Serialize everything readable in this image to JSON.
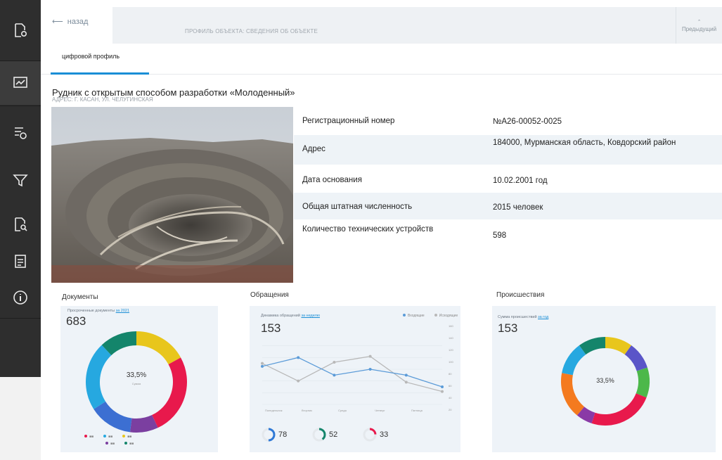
{
  "topbar": {
    "back_label": "назад",
    "title": "ПРОФИЛЬ ОБЪЕКТА: СВЕДЕНИЯ ОБ ОБЪЕКТЕ",
    "prev_label": "Предыдущий"
  },
  "tabs": [
    {
      "label": "цифровой профиль",
      "active": true
    }
  ],
  "page": {
    "title": "Рудник с открытым способом разработки «Молоденный»",
    "subtitle": "АДРЕС: Г. КАСАН, УЛ. ЧЕЛУГИНСКАЯ"
  },
  "info": [
    {
      "label": "Регистрационный номер",
      "value": "№А26-00052-0025"
    },
    {
      "label": "Адрес",
      "value": "184000, Мурманская область, Ковдорский район"
    },
    {
      "label": "Дата основания",
      "value": "10.02.2001 год"
    },
    {
      "label": "Общая штатная численность",
      "value": "2015 человек"
    },
    {
      "label": "Количество технических устройств",
      "value": "598"
    }
  ],
  "documents": {
    "title": "Документы",
    "caption": "Просроченные документы",
    "caption_link": "за 2021",
    "total": "683",
    "center_percent": "33,5%",
    "center_caption": "Сумма",
    "segments": [
      {
        "color": "#e8c61c",
        "value": 17
      },
      {
        "color": "#e8194c",
        "value": 26
      },
      {
        "color": "#7b3fa0",
        "value": 9
      },
      {
        "color": "#3c6fd2",
        "value": 14
      },
      {
        "color": "#26a8e0",
        "value": 22
      },
      {
        "color": "#14856b",
        "value": 12
      }
    ]
  },
  "appeals": {
    "title": "Обращения",
    "caption": "Динамика обращений",
    "caption_link": "за неделю",
    "total": "153",
    "legend": [
      "Входящие",
      "Исходящие"
    ],
    "x_labels": [
      "Понедельник",
      "Вторник",
      "Среда",
      "Четверг",
      "Пятница"
    ],
    "y_labels": [
      "160",
      "140",
      "120",
      "100",
      "80",
      "60",
      "40",
      "20"
    ],
    "series_a": [
      105,
      120,
      90,
      100,
      90,
      70
    ],
    "series_b": [
      110,
      80,
      112,
      122,
      78,
      62
    ],
    "mini": [
      {
        "value": "78",
        "color": "#2f79d6"
      },
      {
        "value": "52",
        "color": "#14856b"
      },
      {
        "value": "33",
        "color": "#e8194c"
      }
    ]
  },
  "incidents": {
    "title": "Происшествия",
    "caption": "Сумма происшествий",
    "caption_link": "за год",
    "total": "153",
    "center_percent": "33,5%",
    "segments": [
      {
        "color": "#e8c61c",
        "value": 10
      },
      {
        "color": "#5a55c8",
        "value": 10
      },
      {
        "color": "#4cb84a",
        "value": 11
      },
      {
        "color": "#e8194c",
        "value": 24
      },
      {
        "color": "#8a3aa6",
        "value": 6
      },
      {
        "color": "#f47a1f",
        "value": 17
      },
      {
        "color": "#26a8e0",
        "value": 12
      },
      {
        "color": "#14856b",
        "value": 10
      }
    ]
  }
}
